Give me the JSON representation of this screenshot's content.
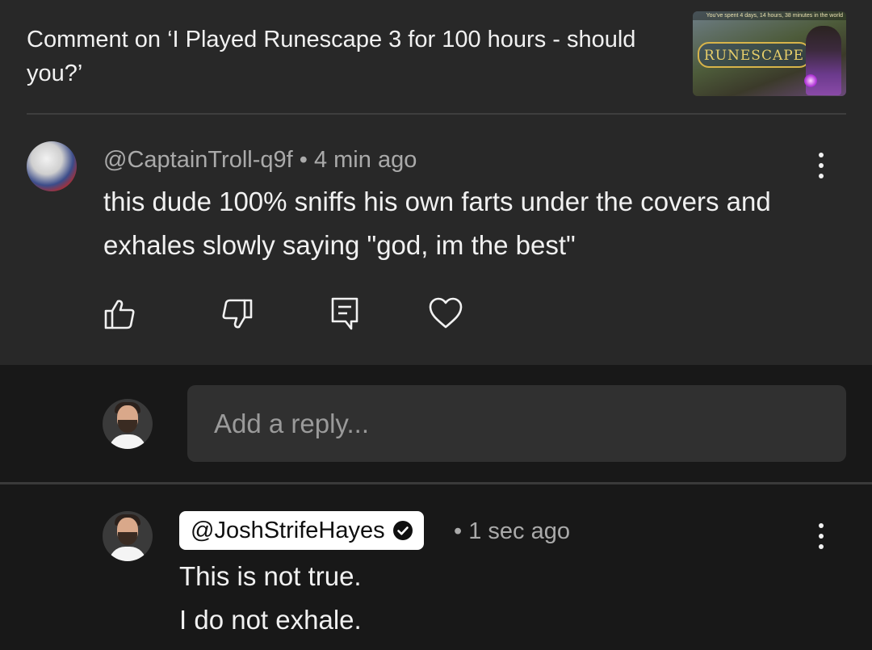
{
  "header": {
    "title": "Comment on ‘I Played Runescape 3 for 100 hours - should you?’",
    "thumbnail": {
      "banner_text": "You’ve spent 4 days, 14 hours, 38 minutes in the world",
      "logo_text": "RUNESCAPE",
      "icon": "video-thumbnail"
    }
  },
  "comment": {
    "author": "@CaptainTroll-q9f",
    "separator": "•",
    "time": "4 min ago",
    "text": "this dude 100% sniffs his own farts under the covers and exhales slowly saying \"god, im the best\"",
    "actions": [
      "thumbs-up-icon",
      "thumbs-down-icon",
      "reply-icon",
      "heart-icon"
    ],
    "menu_icon": "more-vert-icon"
  },
  "reply_box": {
    "placeholder": "Add a reply..."
  },
  "reply": {
    "author": "@JoshStrifeHayes",
    "verified_icon": "verified-check-icon",
    "separator": "•",
    "time": "1 sec ago",
    "lines": [
      "This is not true.",
      "I do not exhale."
    ],
    "menu_icon": "more-vert-icon"
  },
  "colors": {
    "background": "#212121",
    "panel": "#282828",
    "dark_panel": "#181818",
    "text": "#f1f1f1",
    "muted": "#aaaaaa",
    "chip": "#ffffff"
  }
}
